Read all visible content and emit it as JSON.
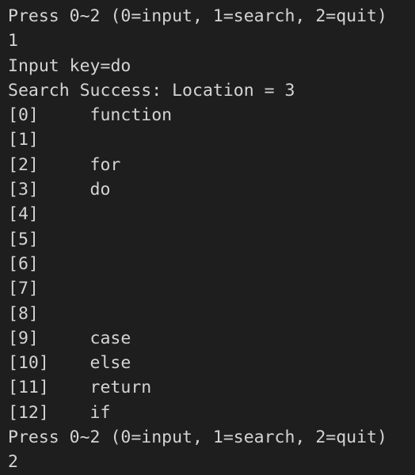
{
  "terminal": {
    "background_color": "#1e1e1e",
    "text_color": "#d4d4d4",
    "prompt_line": "Press 0~2 (0=input, 1=search, 2=quit)",
    "lines": [
      {
        "kind": "text",
        "text": "Press 0~2 (0=input, 1=search, 2=quit)"
      },
      {
        "kind": "text",
        "text": "1"
      },
      {
        "kind": "text",
        "text": "Input key=do"
      },
      {
        "kind": "text",
        "text": "Search Success: Location = 3"
      },
      {
        "kind": "entry",
        "index": "[0]",
        "value": "function"
      },
      {
        "kind": "entry",
        "index": "[1]",
        "value": ""
      },
      {
        "kind": "entry",
        "index": "[2]",
        "value": "for"
      },
      {
        "kind": "entry",
        "index": "[3]",
        "value": "do"
      },
      {
        "kind": "entry",
        "index": "[4]",
        "value": ""
      },
      {
        "kind": "entry",
        "index": "[5]",
        "value": ""
      },
      {
        "kind": "entry",
        "index": "[6]",
        "value": ""
      },
      {
        "kind": "entry",
        "index": "[7]",
        "value": ""
      },
      {
        "kind": "entry",
        "index": "[8]",
        "value": ""
      },
      {
        "kind": "entry",
        "index": "[9]",
        "value": "case"
      },
      {
        "kind": "entry",
        "index": "[10]",
        "value": "else"
      },
      {
        "kind": "entry",
        "index": "[11]",
        "value": "return"
      },
      {
        "kind": "entry",
        "index": "[12]",
        "value": "if"
      },
      {
        "kind": "text",
        "text": "Press 0~2 (0=input, 1=search, 2=quit)"
      },
      {
        "kind": "text",
        "text": "2"
      }
    ],
    "search": {
      "key_label": "Input key=do",
      "key": "do",
      "result_label": "Search Success: Location = 3",
      "location": "3"
    },
    "menu_options": [
      {
        "key": "0",
        "label": "input"
      },
      {
        "key": "1",
        "label": "search"
      },
      {
        "key": "2",
        "label": "quit"
      }
    ],
    "user_inputs": [
      "1",
      "2"
    ]
  }
}
